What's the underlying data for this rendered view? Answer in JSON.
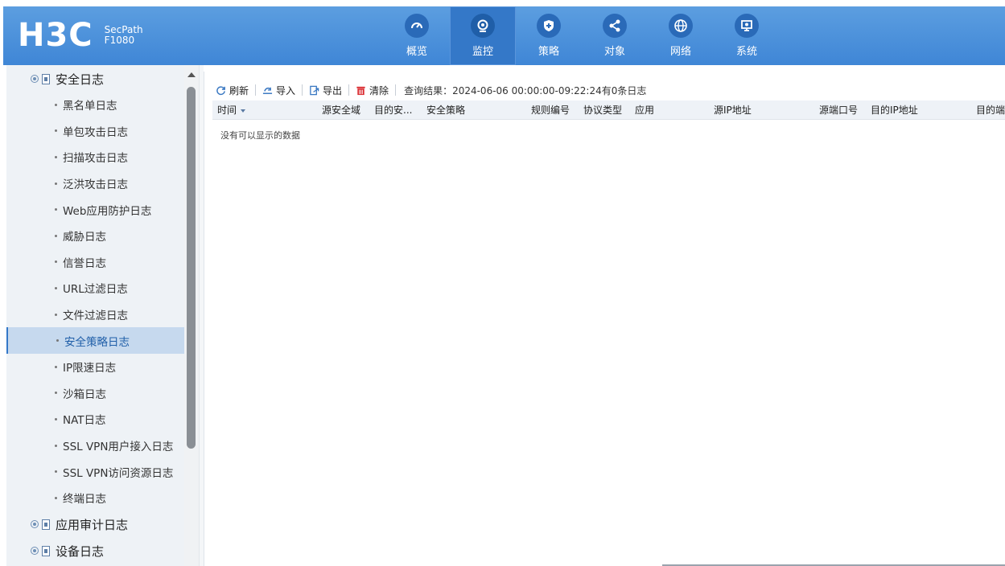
{
  "header": {
    "logo": "H3C",
    "product_line1": "SecPath",
    "product_line2": "F1080",
    "nav": [
      {
        "label": "概览",
        "icon": "gauge-icon",
        "active": false
      },
      {
        "label": "监控",
        "icon": "webcam-icon",
        "active": true
      },
      {
        "label": "策略",
        "icon": "shield-icon",
        "active": false
      },
      {
        "label": "对象",
        "icon": "share-icon",
        "active": false
      },
      {
        "label": "网络",
        "icon": "globe-icon",
        "active": false
      },
      {
        "label": "系统",
        "icon": "monitor-icon",
        "active": false
      }
    ]
  },
  "sidebar": {
    "section_security": "安全日志",
    "items": [
      "黑名单日志",
      "单包攻击日志",
      "扫描攻击日志",
      "泛洪攻击日志",
      "Web应用防护日志",
      "威胁日志",
      "信誉日志",
      "URL过滤日志",
      "文件过滤日志",
      "安全策略日志",
      "IP限速日志",
      "沙箱日志",
      "NAT日志",
      "SSL VPN用户接入日志",
      "SSL VPN访问资源日志",
      "终端日志"
    ],
    "active_item": "安全策略日志",
    "section_app_audit": "应用审计日志",
    "section_device": "设备日志"
  },
  "toolbar": {
    "refresh": "刷新",
    "import": "导入",
    "export": "导出",
    "clear": "清除",
    "query_result": "查询结果：2024-06-06 00:00:00-09:22:24有0条日志"
  },
  "grid": {
    "columns": [
      "时间",
      "源安全域",
      "目的安...",
      "安全策略",
      "规则编号",
      "协议类型",
      "应用",
      "源IP地址",
      "源端口号",
      "目的IP地址",
      "目的端"
    ],
    "empty_text": "没有可以显示的数据"
  },
  "colors": {
    "header_blue": "#4a90dc",
    "active_nav": "#3478c8",
    "sidebar_bg": "#eef2f6",
    "active_item_bg": "#c6d9ee",
    "clear_red": "#d9262b"
  }
}
